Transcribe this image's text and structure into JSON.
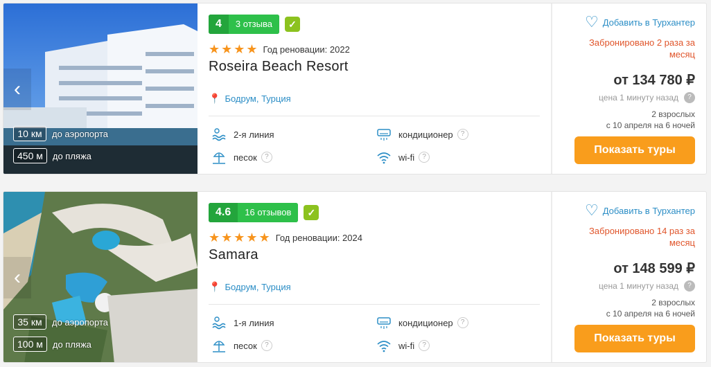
{
  "hotels": [
    {
      "name": "Roseira Beach Resort",
      "score": "4",
      "reviews": "3 отзыва",
      "stars": "★★★★",
      "renovation": "Год реновации: 2022",
      "location": "Бодрум, Турция",
      "airport_distance": "10 км",
      "airport_label": "до аэропорта",
      "beach_distance": "450 м",
      "beach_label": "до пляжа",
      "features": {
        "line": "2-я линия",
        "ac": "кондиционер",
        "beach_type": "песок",
        "wifi": "wi-fi"
      },
      "favorite_label": "Добавить в Турхантер",
      "booked": "Забронировано 2 раза за месяц",
      "price": "от 134 780 ₽",
      "price_updated": "цена 1 минуту назад",
      "pax": "2 взрослых",
      "dates": "с 10 апреля на 6 ночей",
      "button": "Показать туры"
    },
    {
      "name": "Samara",
      "score": "4.6",
      "reviews": "16 отзывов",
      "stars": "★★★★★",
      "renovation": "Год реновации: 2024",
      "location": "Бодрум, Турция",
      "airport_distance": "35 км",
      "airport_label": "до аэропорта",
      "beach_distance": "100 м",
      "beach_label": "до пляжа",
      "features": {
        "line": "1-я линия",
        "ac": "кондиционер",
        "beach_type": "песок",
        "wifi": "wi-fi"
      },
      "favorite_label": "Добавить в Турхантер",
      "booked": "Забронировано 14 раз за месяц",
      "price": "от 148 599 ₽",
      "price_updated": "цена 1 минуту назад",
      "pax": "2 взрослых",
      "dates": "с 10 апреля на 6 ночей",
      "button": "Показать туры"
    }
  ],
  "icons": {
    "prev": "chevron-left-icon",
    "next": "chevron-right-icon",
    "verified": "check-icon",
    "location": "map-pin-icon",
    "favorite": "heart-icon",
    "help": "question-icon"
  },
  "colors": {
    "accent": "#2c8ec6",
    "button": "#f99d1c",
    "rating": "#23a53c",
    "booked": "#e0552b",
    "stars": "#f7941d"
  }
}
